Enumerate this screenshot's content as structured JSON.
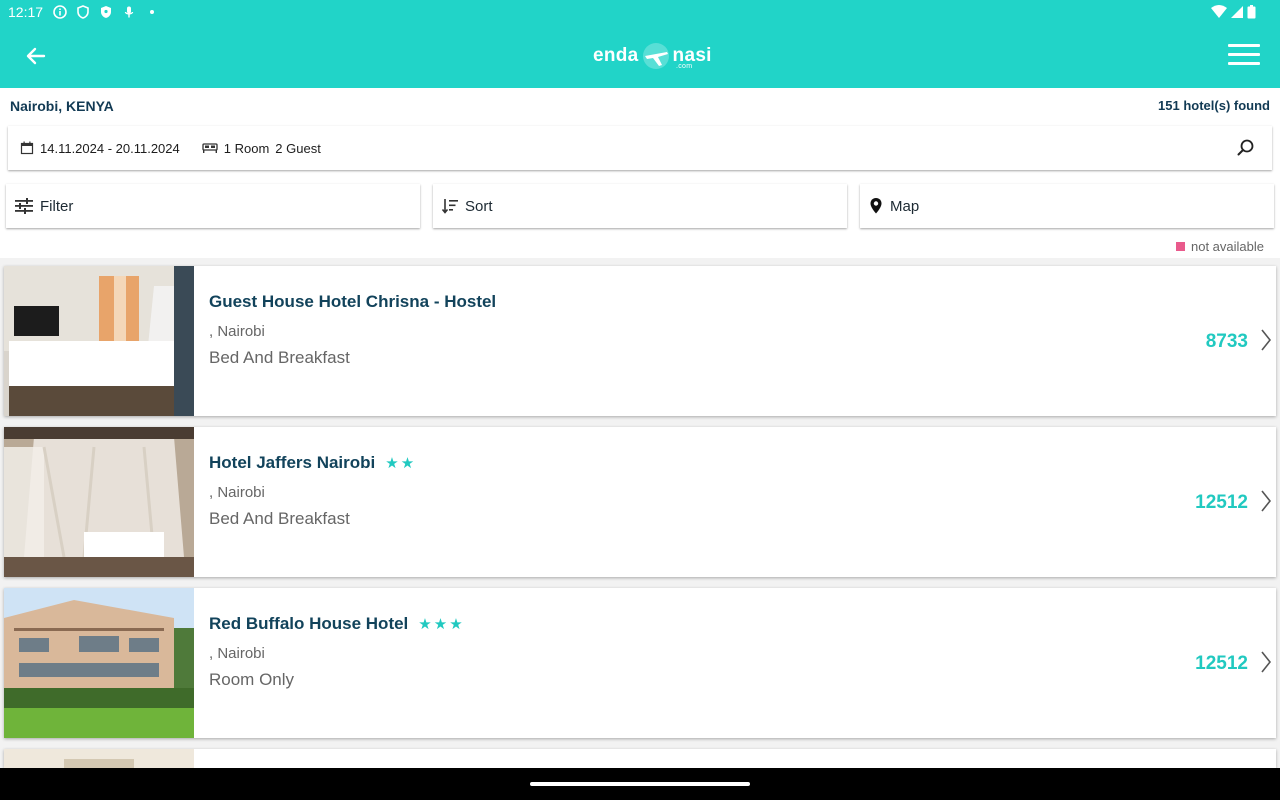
{
  "status_bar": {
    "time": "12:17"
  },
  "app": {
    "brand_left": "enda",
    "brand_right": "nasi",
    "brand_suffix": ".com"
  },
  "search_summary": {
    "location": "Nairobi, KENYA",
    "results": "151 hotel(s) found",
    "dates": "14.11.2024 - 20.11.2024",
    "rooms": "1 Room",
    "guests": "2 Guest"
  },
  "toolbar": {
    "filter": "Filter",
    "sort": "Sort",
    "map": "Map"
  },
  "legend": {
    "label": "not available",
    "color": "#e95a8c"
  },
  "colors": {
    "accent": "#21d4c8",
    "price": "#21c9c0",
    "title": "#12435b"
  },
  "hotels": [
    {
      "name": "Guest House Hotel Chrisna - Hostel",
      "stars": "",
      "city": ", Nairobi",
      "board": "Bed And Breakfast",
      "price": "8733"
    },
    {
      "name": "Hotel Jaffers Nairobi",
      "stars": "★★",
      "city": ", Nairobi",
      "board": "Bed And Breakfast",
      "price": "12512"
    },
    {
      "name": "Red Buffalo House Hotel",
      "stars": "★★★",
      "city": ", Nairobi",
      "board": "Room Only",
      "price": "12512"
    }
  ]
}
